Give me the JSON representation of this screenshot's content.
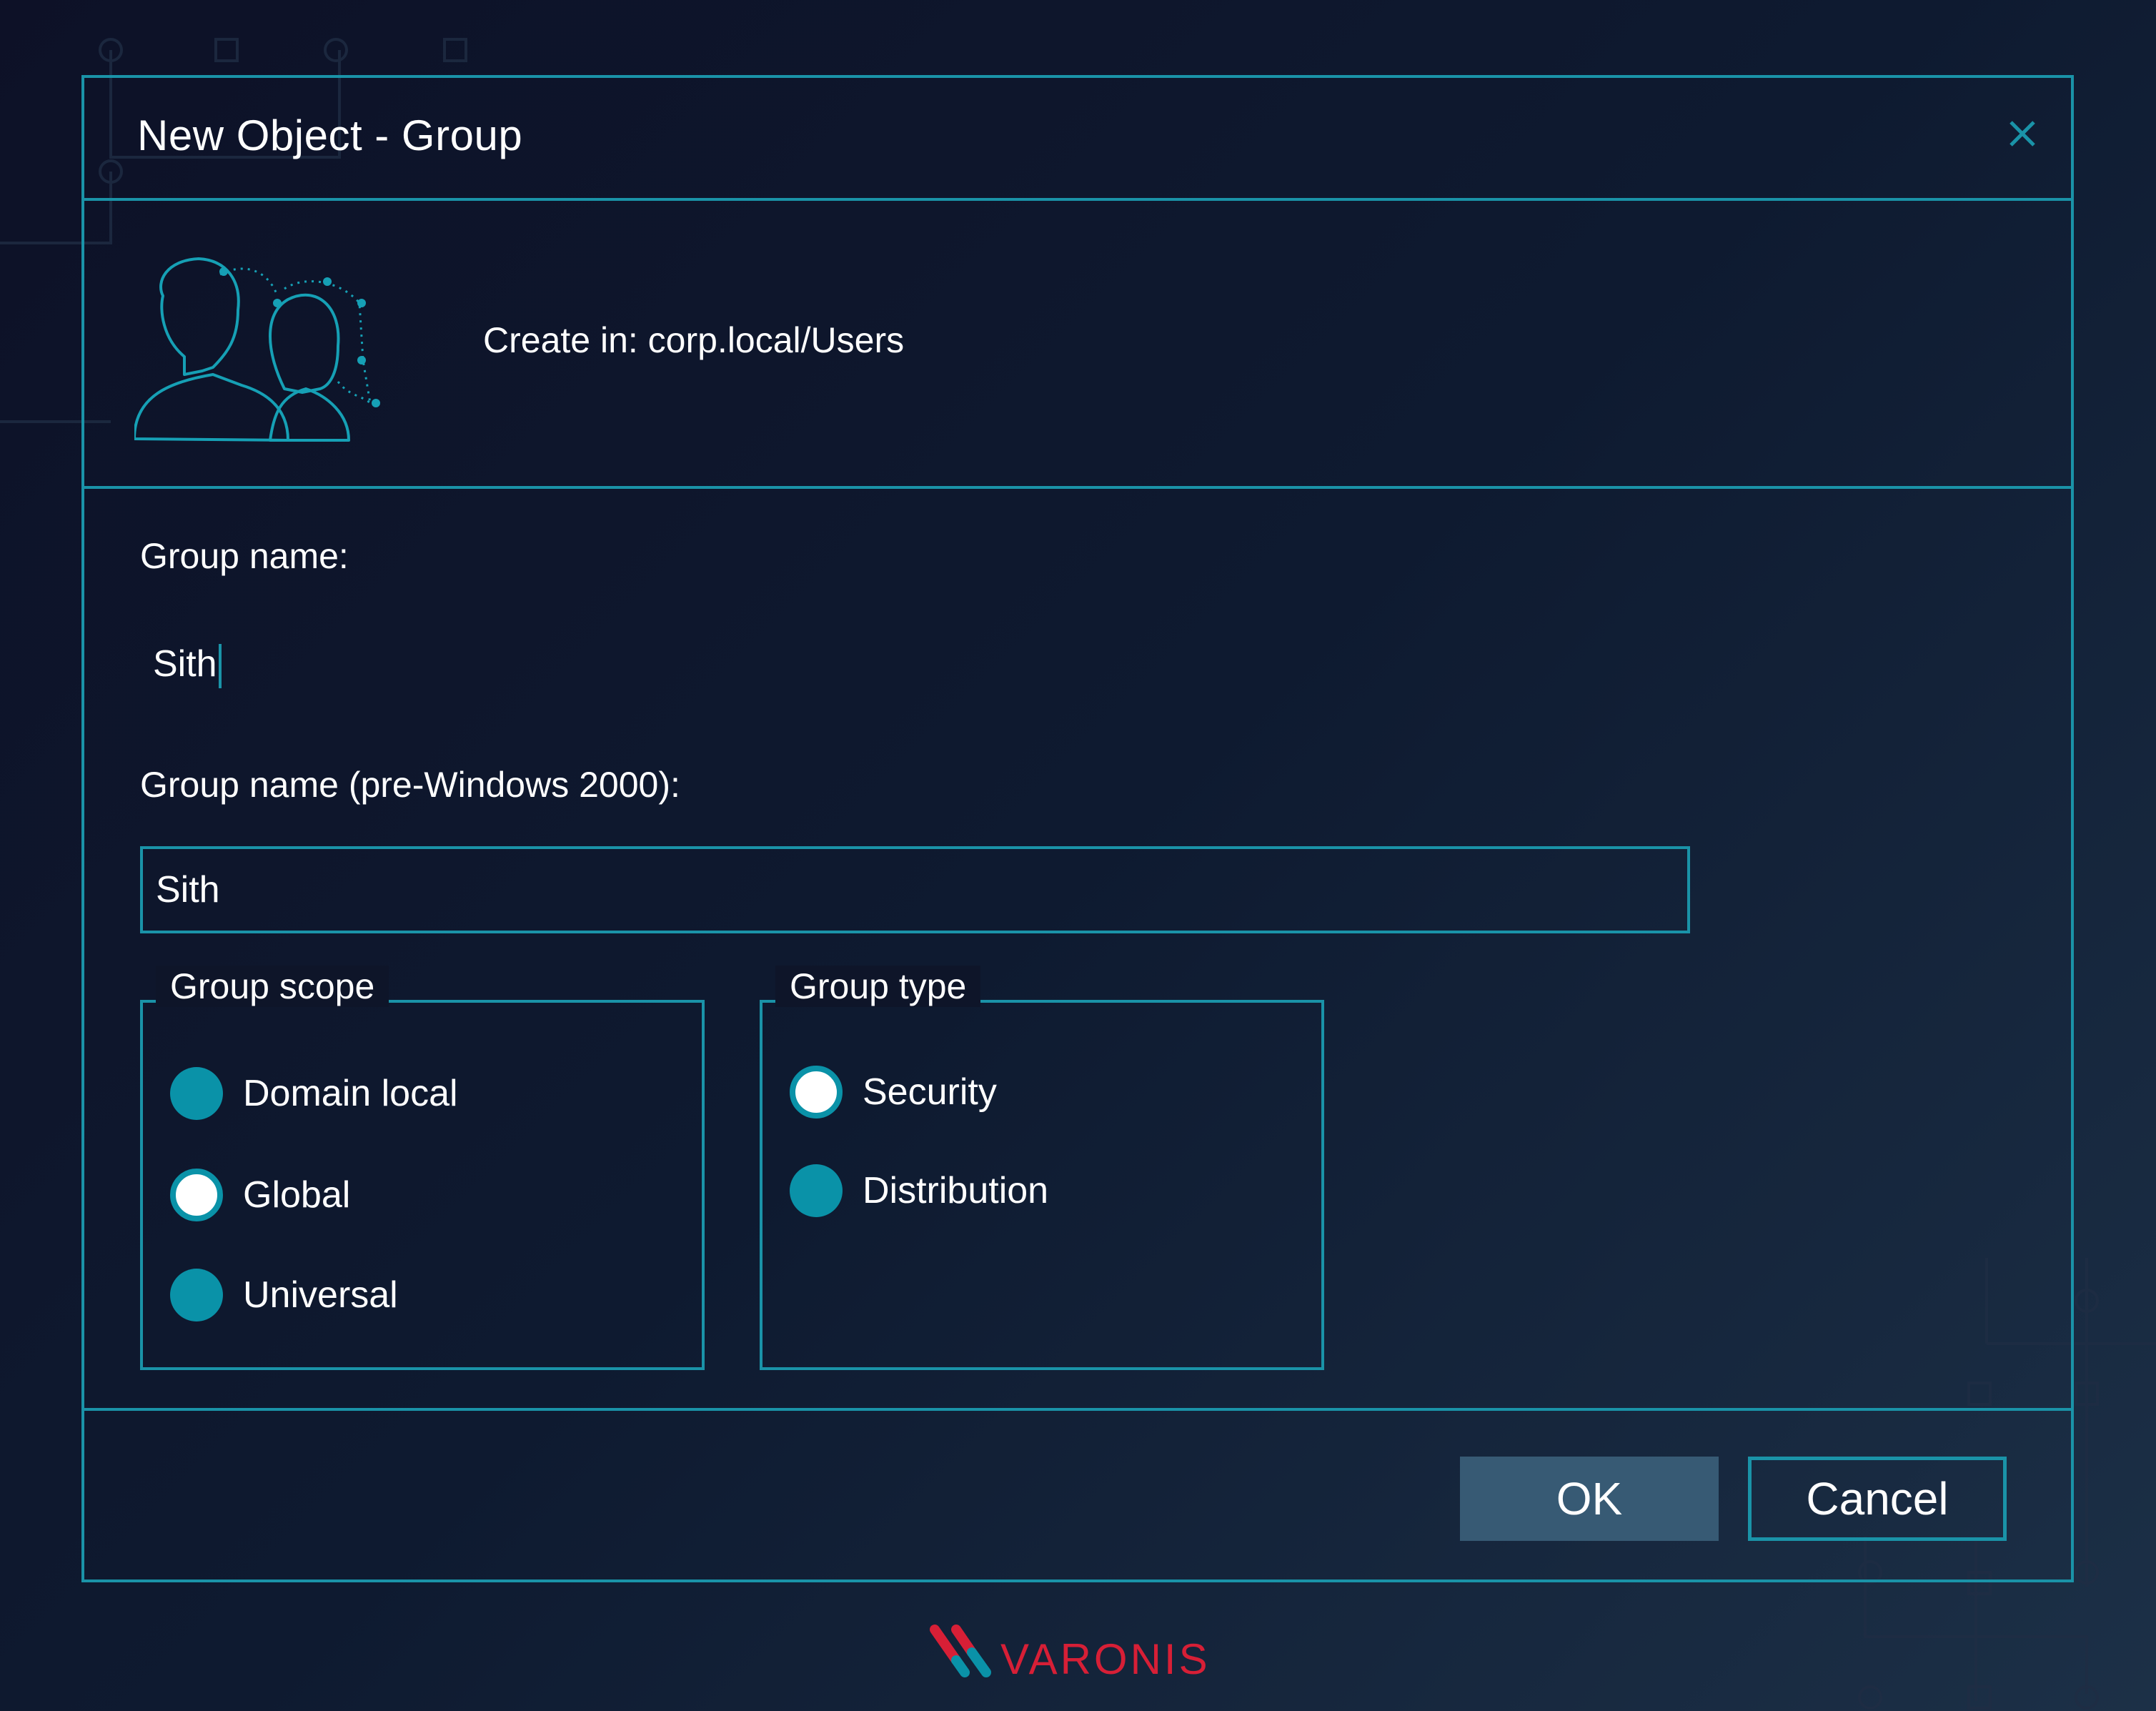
{
  "dialog": {
    "title": "New Object - Group",
    "close_icon": "close-icon",
    "header_icon": "user-group-icon",
    "create_in": "Create in: corp.local/Users"
  },
  "form": {
    "group_name_label": "Group name:",
    "group_name_value": "Sith",
    "pre2000_label": "Group name (pre-Windows 2000):",
    "pre2000_value": "Sith"
  },
  "group_scope": {
    "legend": "Group scope",
    "options": [
      {
        "label": "Domain local",
        "selected": false
      },
      {
        "label": "Global",
        "selected": true
      },
      {
        "label": "Universal",
        "selected": false
      }
    ]
  },
  "group_type": {
    "legend": "Group type",
    "options": [
      {
        "label": "Security",
        "selected": true
      },
      {
        "label": "Distribution",
        "selected": false
      }
    ]
  },
  "buttons": {
    "ok": "OK",
    "cancel": "Cancel"
  },
  "brand": {
    "name": "VARONIS",
    "primary": "#d71f36",
    "accent": "#0a92a8"
  },
  "colors": {
    "border": "#1a93a8",
    "ok_fill": "#375a74",
    "radio": "#0a92a8"
  }
}
